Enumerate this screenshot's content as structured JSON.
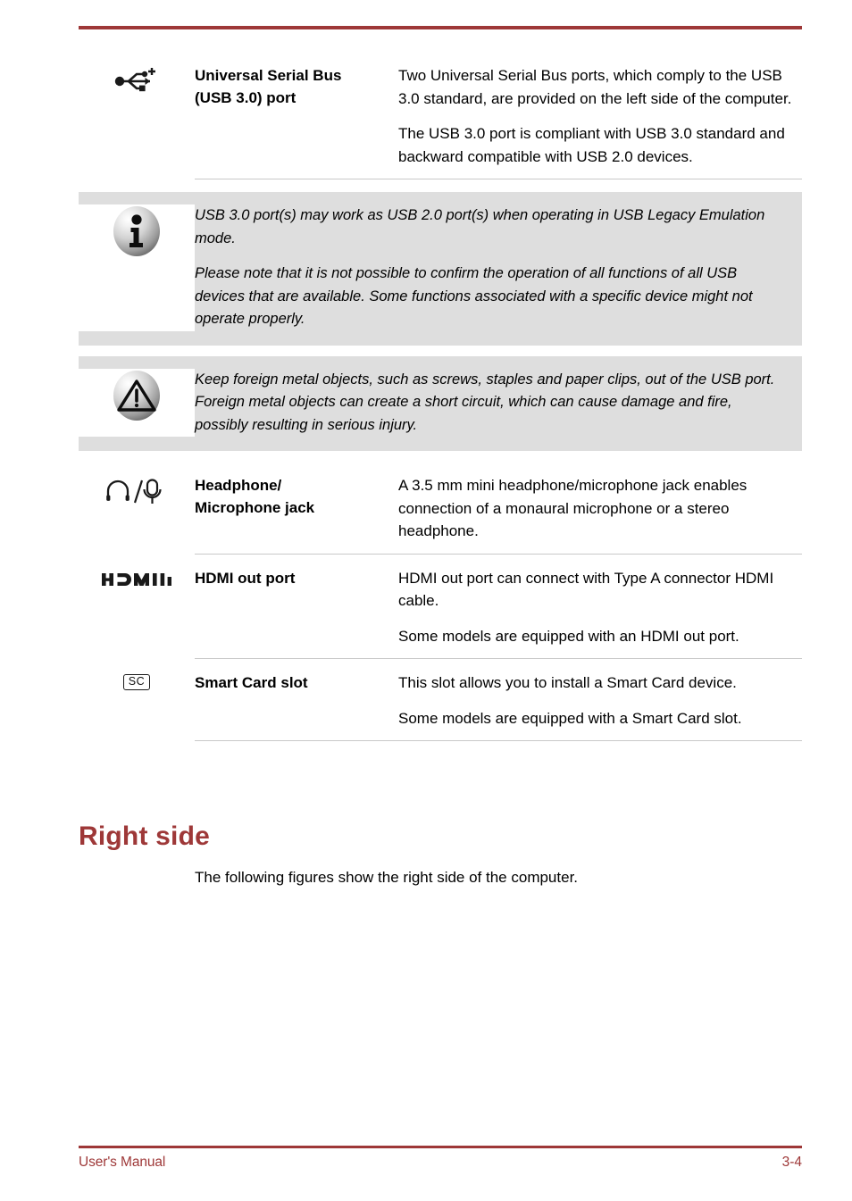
{
  "document": {
    "footer_left": "User's Manual",
    "footer_page": "3-4",
    "accent_color": "#9e3838",
    "callout_bg": "#dedede",
    "rule_color": "#c8c8c8"
  },
  "spec_rows": [
    {
      "icon": "usb-3-icon",
      "label_line1": "Universal Serial Bus",
      "label_line2": "(USB 3.0) port",
      "paragraphs": [
        "Two Universal Serial Bus ports, which comply to the USB 3.0 standard, are provided on the left side of the computer.",
        "The USB 3.0 port is compliant with USB 3.0 standard and backward compatible with USB 2.0 devices."
      ]
    },
    {
      "icon": "headphone-microphone-icon",
      "label_line1": "Headphone/",
      "label_line2": "Microphone jack",
      "paragraphs": [
        "A 3.5 mm mini headphone/microphone jack enables connection of a monaural microphone or a stereo headphone."
      ]
    },
    {
      "icon": "hdmi-icon",
      "label_line1": "HDMI out port",
      "label_line2": "",
      "paragraphs": [
        "HDMI out port can connect with Type A connector HDMI cable.",
        "Some models are equipped with an HDMI out port."
      ]
    },
    {
      "icon": "smart-card-icon",
      "label_line1": "Smart Card slot",
      "label_line2": "",
      "paragraphs": [
        "This slot allows you to install a Smart Card device.",
        "Some models are equipped with a Smart Card slot."
      ]
    }
  ],
  "callouts": [
    {
      "icon": "info-icon",
      "paragraphs": [
        "USB 3.0 port(s) may work as USB 2.0 port(s) when operating in USB Legacy Emulation mode.",
        "Please note that it is not possible to confirm the operation of all functions of all USB devices that are available. Some functions associated with a specific device might not operate properly."
      ]
    },
    {
      "icon": "warning-icon",
      "paragraphs": [
        "Keep foreign metal objects, such as screws, staples and paper clips, out of the USB port. Foreign metal objects can create a short circuit, which can cause damage and fire, possibly resulting in serious injury."
      ]
    }
  ],
  "section": {
    "heading": "Right side",
    "paragraph": "The following figures show the right side of the computer."
  },
  "icon_labels": {
    "smart_card_text": "SC"
  }
}
